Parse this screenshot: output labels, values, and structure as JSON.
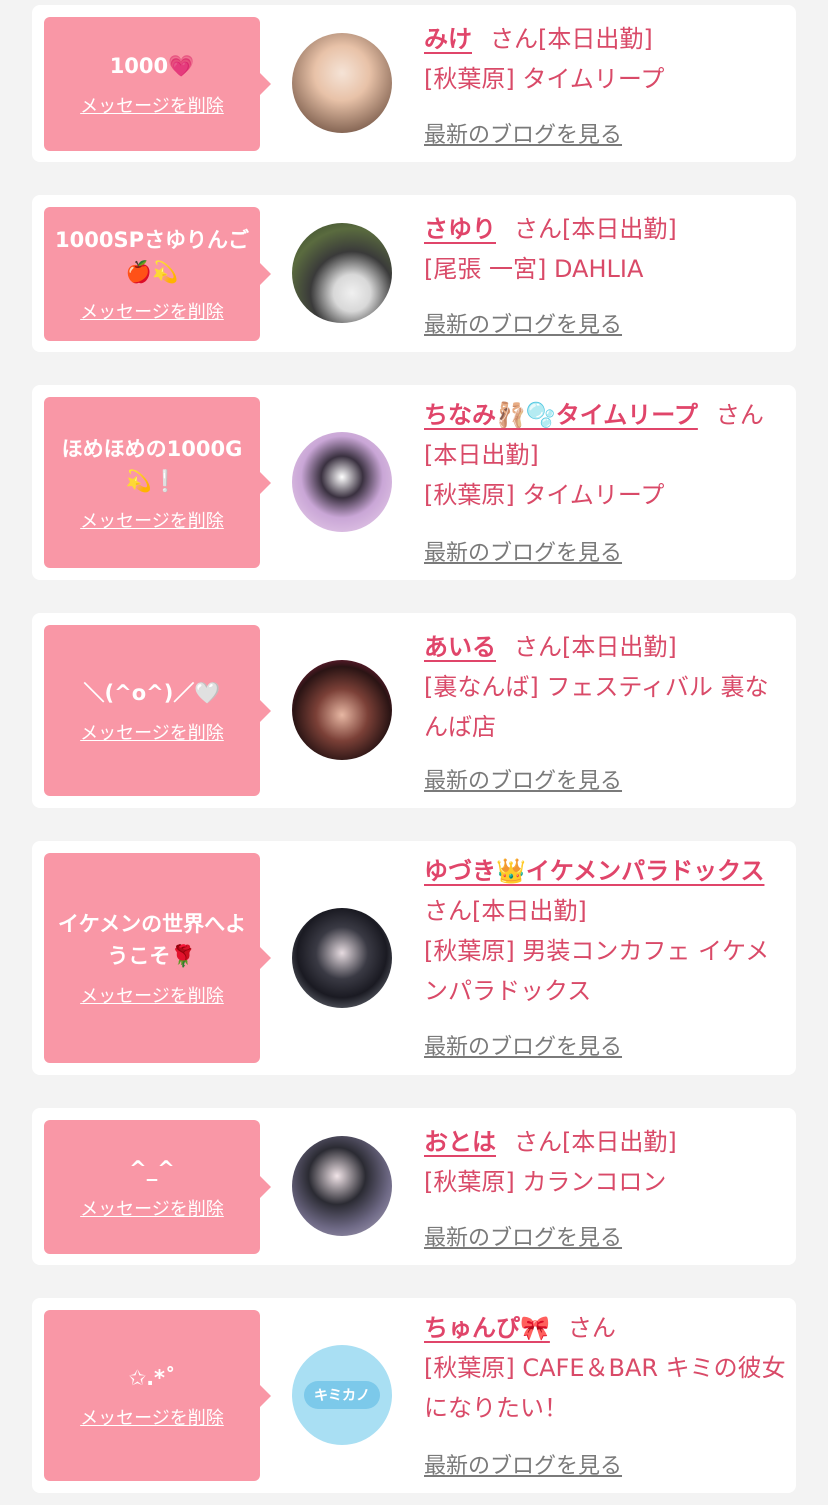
{
  "common": {
    "delete_label": "メッセージを削除",
    "blog_label": "最新のブログを見る",
    "san": "さん"
  },
  "colors": {
    "bubble": "#f997a6",
    "name": "#e0456a",
    "text": "#d94a68",
    "link_gray": "#7a7a7a",
    "background": "#f3f3f3"
  },
  "cards": [
    {
      "message": "1000💗",
      "name": "みけ",
      "status": "[本日出勤]",
      "shop": "[秋葉原] タイムリープ"
    },
    {
      "message": "1000SPさゆりんご🍎💫",
      "name": "さゆり",
      "status": "[本日出勤]",
      "shop": "[尾張 一宮] DAHLIA"
    },
    {
      "message": "ほめほめの1000G💫❕",
      "name": "ちなみ🩰🫧タイムリープ",
      "status": "[本日出勤]",
      "shop": "[秋葉原] タイムリープ"
    },
    {
      "message": "＼(^o^)／🤍",
      "name": "あいる",
      "status": "[本日出勤]",
      "shop": "[裏なんば] フェスティバル 裏なんば店"
    },
    {
      "message": "イケメンの世界へようこそ🌹",
      "name": "ゆづき👑イケメンパラドックス",
      "status": "[本日出勤]",
      "shop": "[秋葉原] 男装コンカフェ イケメンパラドックス"
    },
    {
      "message": "^_^",
      "name": "おとは",
      "status": "[本日出勤]",
      "shop": "[秋葉原] カランコロン"
    },
    {
      "message": "✩.*˚",
      "name": "ちゅんぴ🎀",
      "status": "",
      "shop": "[秋葉原] CAFE＆BAR キミの彼女になりたい！",
      "avatar_text": "キミカノ"
    }
  ]
}
